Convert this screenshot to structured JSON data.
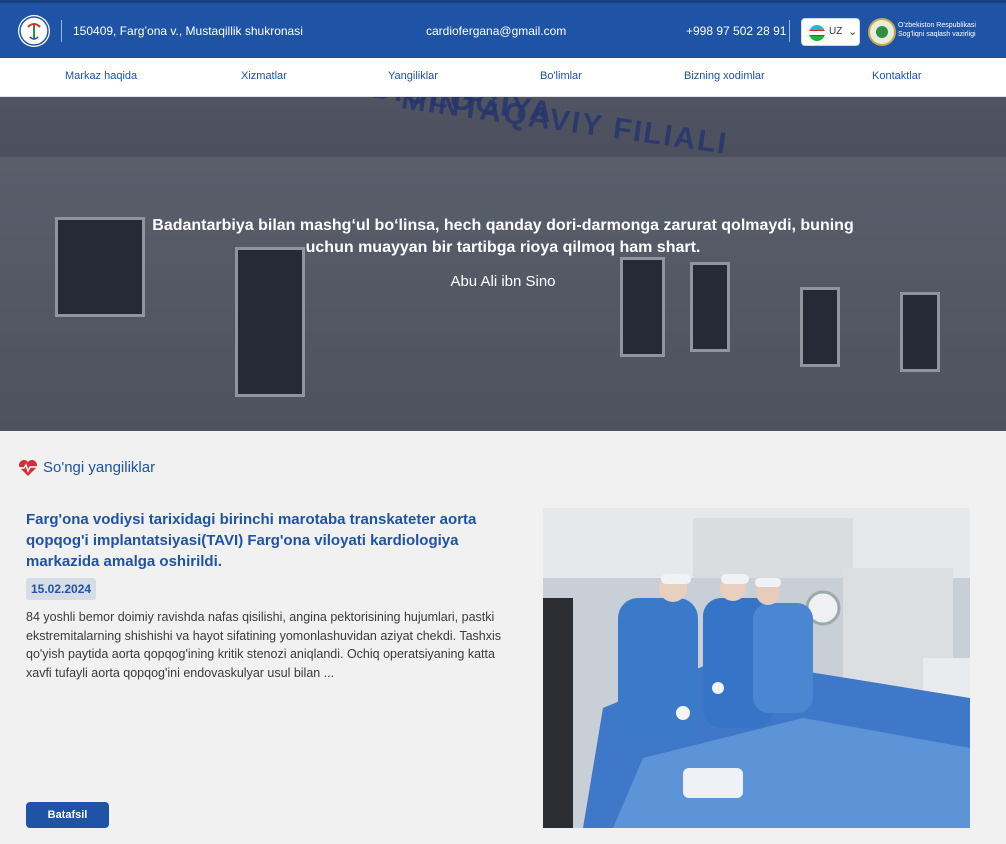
{
  "header": {
    "address": "150409, Farg’ona v., Mustaqillik shukronasi",
    "email": "cardiofergana@gmail.com",
    "phone": "+998 97 502 28 91",
    "language": "UZ",
    "ministry_name": "O'zbekiston Respublikasi Sog'liqni saqlash vazirligi",
    "colors": {
      "primary": "#1e53a6",
      "nav_bg": "#ffffff"
    }
  },
  "nav": {
    "items": [
      "Markaz haqida",
      "Xizmatlar",
      "Yangiliklar",
      "Bo'limlar",
      "Bizning xodimlar",
      "Kontaktlar"
    ]
  },
  "hero": {
    "sign_text_1": "KARDIOLOGIYA",
    "sign_text_2": "MINTAQAVIY FILIALI",
    "quote": "Badantarbiya bilan mashg‘ul bo‘linsa, hech qanday dori-darmonga zarurat qolmaydi, buning uchun muayyan bir tartibga rioya qilmoq ham shart.",
    "author": "Abu Ali ibn Sino"
  },
  "news": {
    "heading": "So'ngi yangiliklar",
    "heading_icon": "heart-pulse-icon",
    "article": {
      "title": "Farg'ona vodiysi tarixidagi birinchi marotaba transkateter aorta qopqog'i implantatsiyasi(TAVI) Farg'ona viloyati kardiologiya markazida amalga oshirildi.",
      "date": "15.02.2024",
      "excerpt": "84 yoshli bemor doimiy ravishda nafas qisilishi, angina pektorisining hujumlari, pastki ekstremitalarning shishishi va hayot sifatining yomonlashuvidan aziyat chekdi. Tashxis qo'yish paytida aorta qopqog'ining kritik stenozi aniqlandi. Ochiq operatsiyaning katta xavfi tufayli aorta qopqog'ini endovaskulyar usul bilan ...",
      "button_label": "Batafsil"
    }
  }
}
